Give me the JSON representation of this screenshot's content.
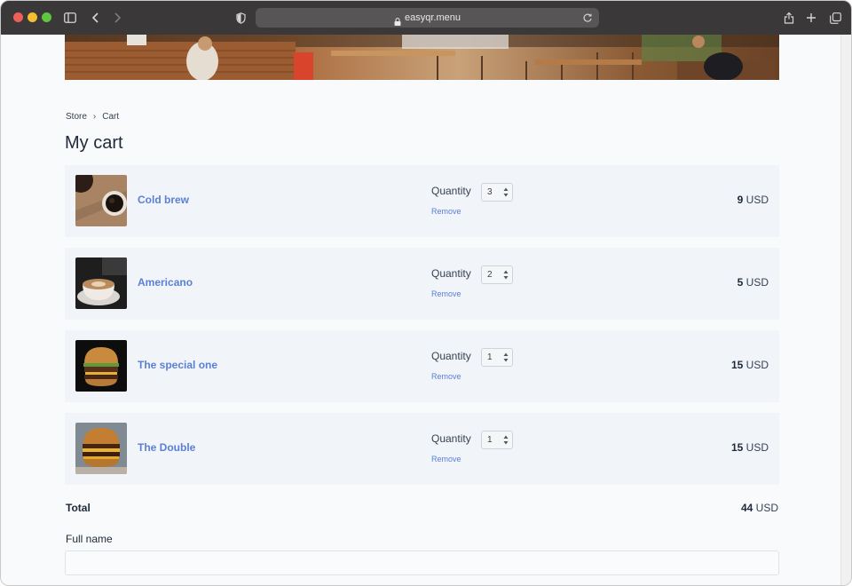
{
  "browser": {
    "url": "easyqr.menu"
  },
  "breadcrumb": {
    "store": "Store",
    "separator": "›",
    "cart": "Cart"
  },
  "page": {
    "title": "My cart"
  },
  "cart": {
    "quantity_label": "Quantity",
    "remove_label": "Remove",
    "currency": "USD",
    "items": [
      {
        "name": "Cold brew",
        "quantity": "3",
        "price": "9"
      },
      {
        "name": "Americano",
        "quantity": "2",
        "price": "5"
      },
      {
        "name": "The special one",
        "quantity": "1",
        "price": "15"
      },
      {
        "name": "The Double",
        "quantity": "1",
        "price": "15"
      }
    ],
    "total_label": "Total",
    "total_value": "44"
  },
  "form": {
    "full_name_label": "Full name",
    "full_name_value": ""
  },
  "colors": {
    "link": "#5b7fd6",
    "card_background": "#f1f5fa",
    "toolbar": "#3a3838"
  }
}
